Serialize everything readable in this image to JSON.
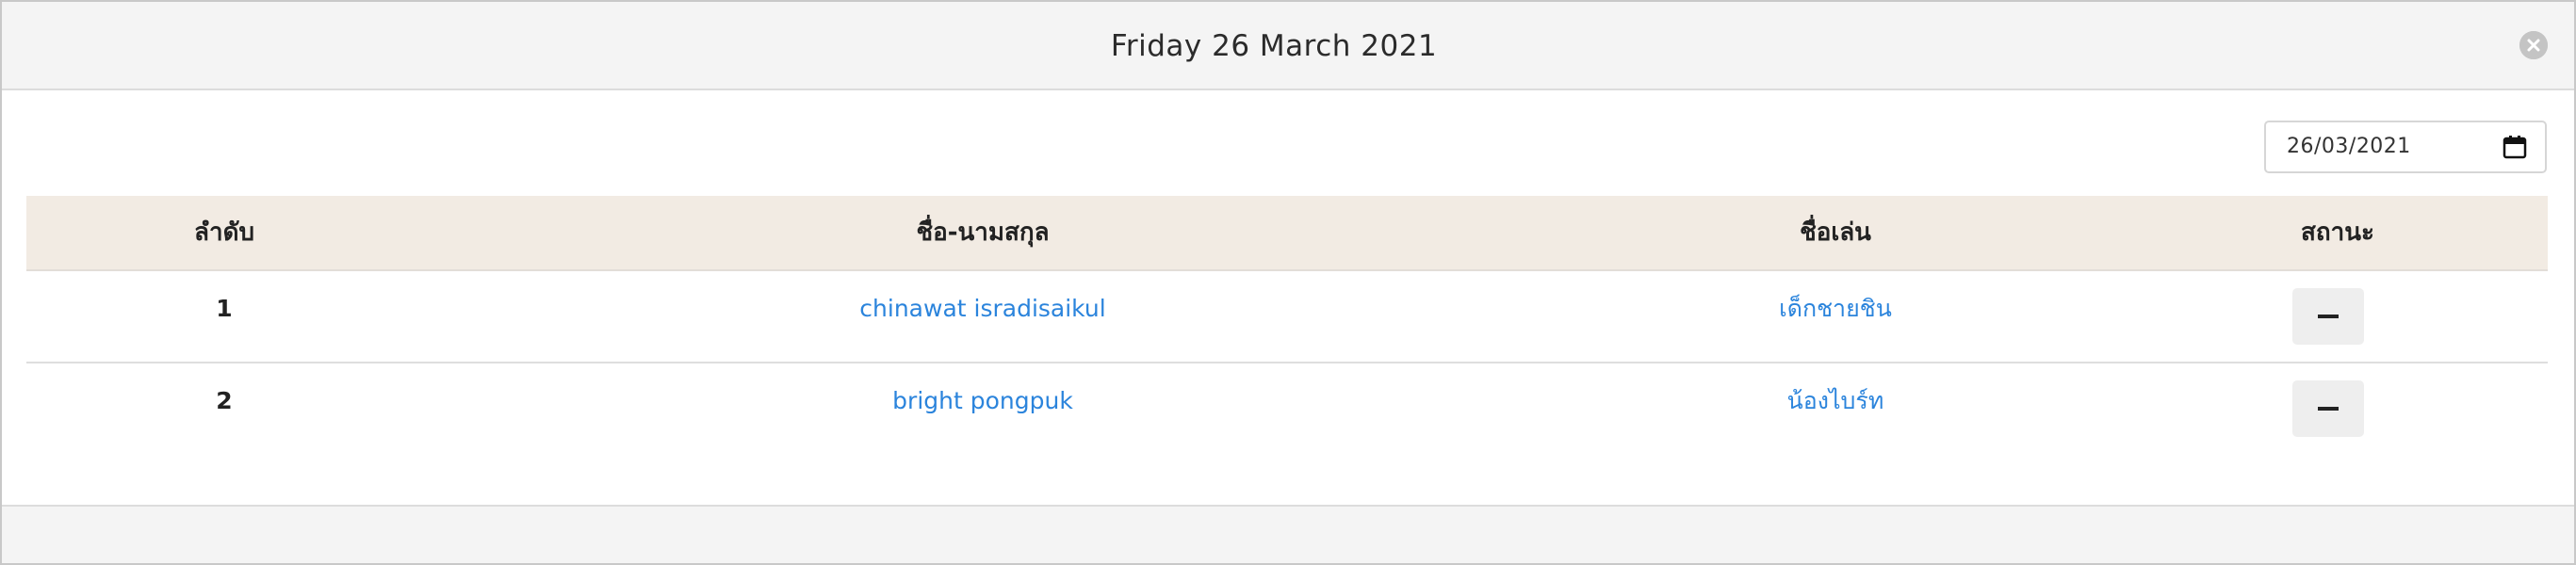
{
  "header": {
    "title": "Friday 26 March 2021",
    "close_icon": "close-circle-icon"
  },
  "date_picker": {
    "value": "26/03/2021",
    "icon": "calendar-icon"
  },
  "table": {
    "columns": [
      "ลำดับ",
      "ชื่อ-นามสกุล",
      "ชื่อเล่น",
      "สถานะ"
    ],
    "rows": [
      {
        "number": "1",
        "full_name": "chinawat isradisaikul",
        "nickname": "เด็กชายชิน",
        "status_icon": "minus-icon"
      },
      {
        "number": "2",
        "full_name": "bright pongpuk",
        "nickname": "น้องไบร์ท",
        "status_icon": "minus-icon"
      }
    ]
  },
  "colors": {
    "link": "#2b84dc",
    "header_bg": "#f4f4f4",
    "table_head_bg": "#f2ebe3"
  }
}
